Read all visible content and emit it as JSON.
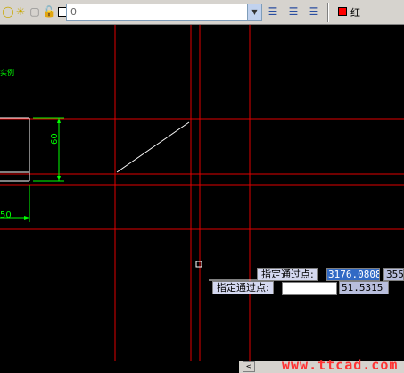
{
  "toolbar": {
    "icons": [
      "lightbulb-icon",
      "sun-icon",
      "freeze-icon",
      "lock-icon",
      "color-square-icon"
    ],
    "layer_value": "0",
    "layer_buttons": [
      "layer-manager-icon",
      "layer-states-icon",
      "layer-previous-icon"
    ],
    "color": {
      "label": "红",
      "swatch": "#ff0000"
    }
  },
  "drawing": {
    "background": "#000000",
    "line_color": "#ff0000",
    "dimension_color": "#00ff00",
    "tag_text": "实例",
    "dim_vertical": "60",
    "dim_horizontal": "50"
  },
  "prompts": {
    "primary_label": "指定通过点:",
    "primary_value": "3176.0808",
    "primary_value_next": "355",
    "secondary_label": "指定通过点:",
    "secondary_value": "",
    "secondary_value_next": "51.5315"
  },
  "footer": {
    "scroll_left": "<",
    "watermark": "www.ttcad.com"
  }
}
